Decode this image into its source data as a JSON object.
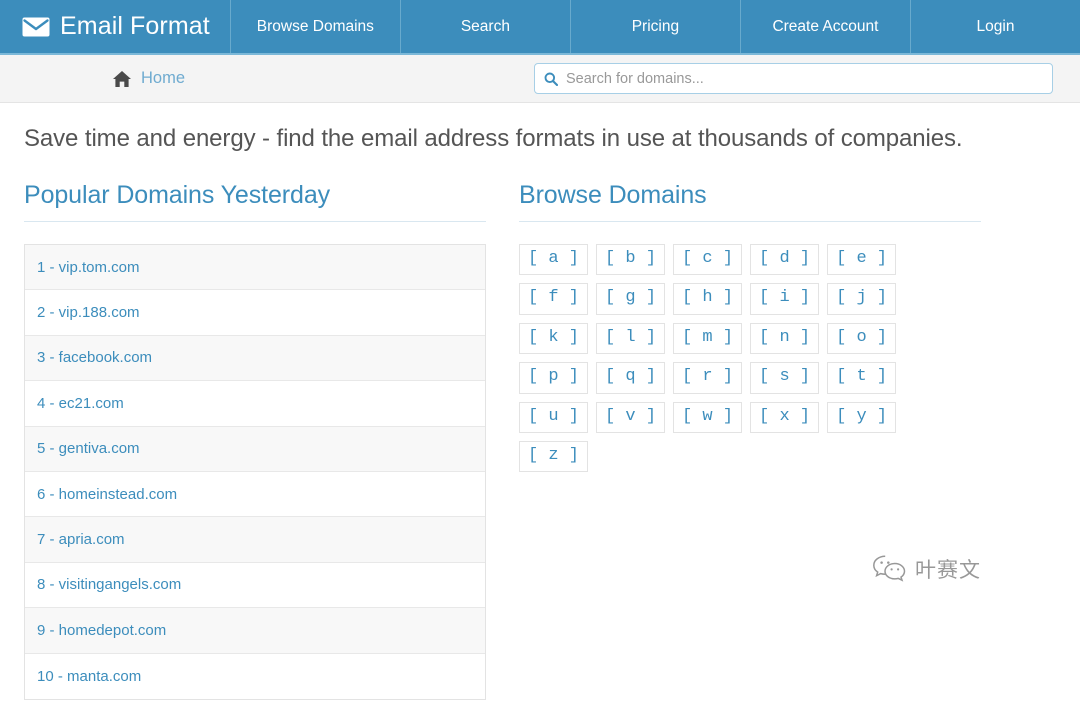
{
  "navbar": {
    "brand": "Email Format",
    "brand_icon": "envelope-icon",
    "accent_color": "#3c8dbc",
    "links": [
      {
        "label": "Browse Domains"
      },
      {
        "label": "Search"
      },
      {
        "label": "Pricing"
      },
      {
        "label": "Create Account"
      },
      {
        "label": "Login"
      }
    ]
  },
  "subbar": {
    "breadcrumb": {
      "icon": "home-icon",
      "label": "Home"
    },
    "search": {
      "icon": "search-icon",
      "placeholder": "Search for domains...",
      "value": ""
    }
  },
  "main": {
    "tagline": "Save time and energy - find the email address formats in use at thousands of companies.",
    "popular": {
      "title": "Popular Domains Yesterday",
      "items": [
        {
          "label": "1 - vip.tom.com"
        },
        {
          "label": "2 - vip.188.com"
        },
        {
          "label": "3 - facebook.com"
        },
        {
          "label": "4 - ec21.com"
        },
        {
          "label": "5 - gentiva.com"
        },
        {
          "label": "6 - homeinstead.com"
        },
        {
          "label": "7 - apria.com"
        },
        {
          "label": "8 - visitingangels.com"
        },
        {
          "label": "9 - homedepot.com"
        },
        {
          "label": "10 - manta.com"
        }
      ]
    },
    "browse": {
      "title": "Browse Domains",
      "letters": [
        {
          "label": "[ a ]"
        },
        {
          "label": "[ b ]"
        },
        {
          "label": "[ c ]"
        },
        {
          "label": "[ d ]"
        },
        {
          "label": "[ e ]"
        },
        {
          "label": "[ f ]"
        },
        {
          "label": "[ g ]"
        },
        {
          "label": "[ h ]"
        },
        {
          "label": "[ i ]"
        },
        {
          "label": "[ j ]"
        },
        {
          "label": "[ k ]"
        },
        {
          "label": "[ l ]"
        },
        {
          "label": "[ m ]"
        },
        {
          "label": "[ n ]"
        },
        {
          "label": "[ o ]"
        },
        {
          "label": "[ p ]"
        },
        {
          "label": "[ q ]"
        },
        {
          "label": "[ r ]"
        },
        {
          "label": "[ s ]"
        },
        {
          "label": "[ t ]"
        },
        {
          "label": "[ u ]"
        },
        {
          "label": "[ v ]"
        },
        {
          "label": "[ w ]"
        },
        {
          "label": "[ x ]"
        },
        {
          "label": "[ y ]"
        },
        {
          "label": "[ z ]"
        }
      ]
    }
  },
  "watermark": {
    "icon": "wechat-icon",
    "text": "叶赛文"
  }
}
